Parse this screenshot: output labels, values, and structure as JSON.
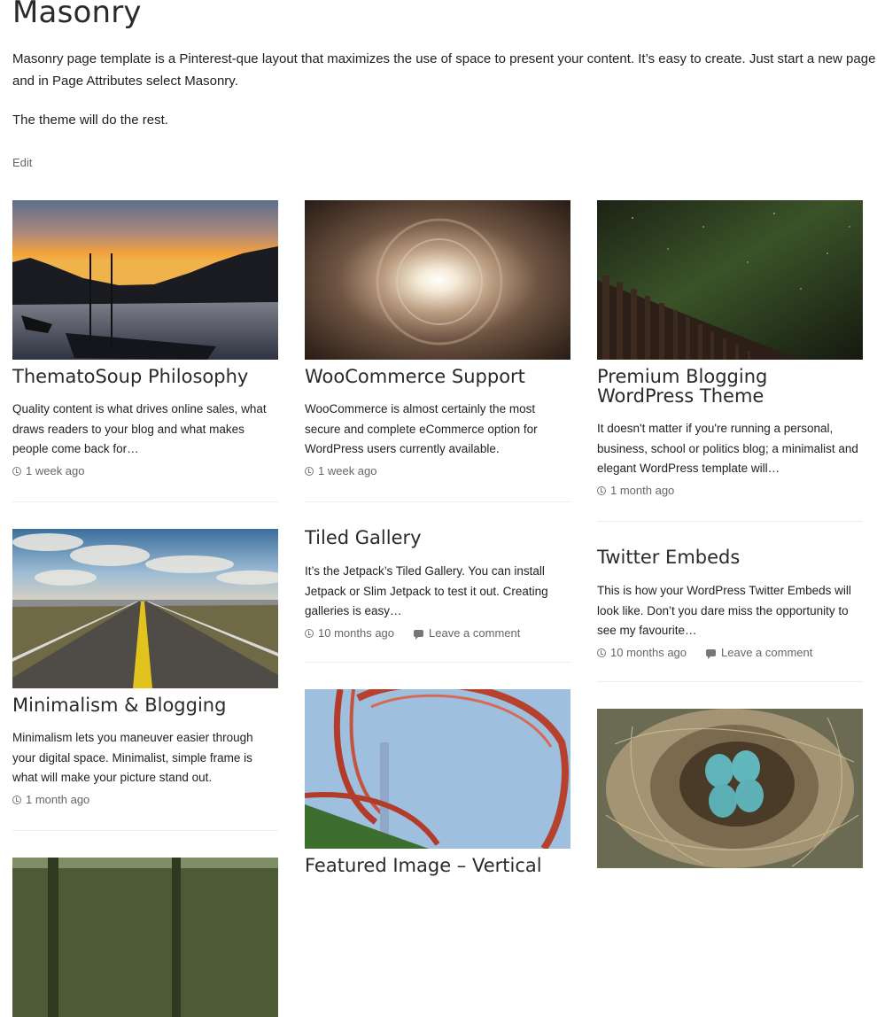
{
  "page": {
    "title": "Masonry",
    "intro": "Masonry page template is a Pinterest-que layout that maximizes the use of space to present your content. It’s easy to create. Just start a new page and in Page Attributes select Masonry.",
    "intro2": "The theme will do the rest.",
    "edit": "Edit"
  },
  "posts": [
    {
      "title": "ThematoSoup Philosophy",
      "excerpt": "Quality content is what drives online sales, what draws readers to your blog and what makes people come back for…",
      "time": "1 week ago",
      "image": "sunset-harbor"
    },
    {
      "title": "WooCommerce Support",
      "excerpt": "WooCommerce is almost certainly the most secure and complete eCommerce option for WordPress users currently available.",
      "time": "1 week ago",
      "image": "tunnel"
    },
    {
      "title": "Premium Blogging WordPress Theme",
      "excerpt": "It doesn't matter if you're running a personal, business, school or politics blog; a minimalist and elegant WordPress template will…",
      "time": "1 month ago",
      "image": "night-sky-fence"
    },
    {
      "title": "Minimalism & Blogging",
      "excerpt": "Minimalism lets you maneuver easier through your digital space. Minimalist, simple frame is what will make your picture stand out.",
      "time": "1 month ago",
      "image": "desert-road"
    },
    {
      "title": "Tiled Gallery",
      "excerpt": "It’s the Jetpack’s Tiled Gallery. You can install Jetpack or Slim Jetpack to test it out. Creating galleries is easy…",
      "time": "10 months ago",
      "comment": "Leave a comment"
    },
    {
      "title": "Twitter Embeds",
      "excerpt": "This is how your WordPress Twitter Embeds will look like. Don’t you dare miss the opportunity to see my favourite…",
      "time": "10 months ago",
      "comment": "Leave a comment"
    },
    {
      "title": "Featured Image – Vertical",
      "image": "rollercoaster"
    },
    {
      "image": "bird-nest"
    },
    {
      "image": "forest"
    }
  ]
}
